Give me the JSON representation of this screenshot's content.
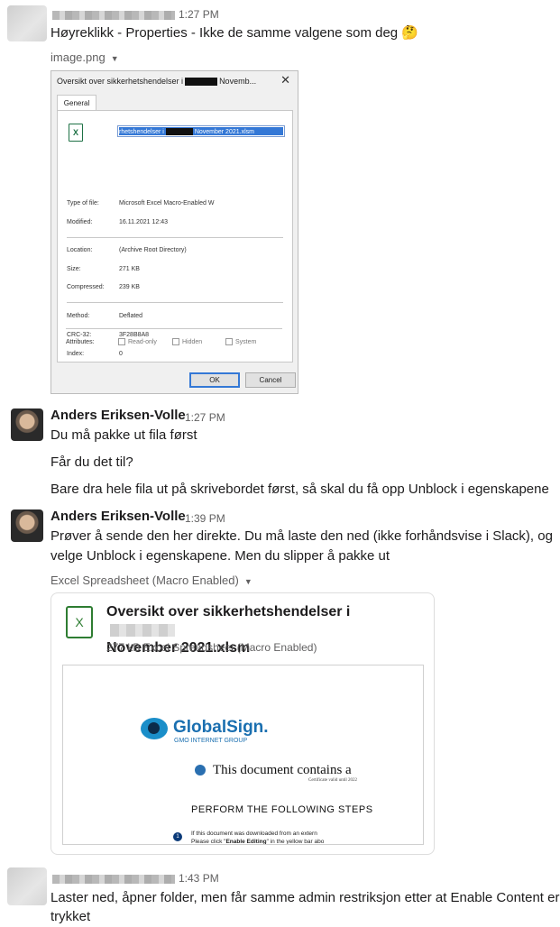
{
  "messages": [
    {
      "time": "1:27 PM",
      "text": "Høyreklikk - Properties - Ikke de samme valgene som deg 🤔",
      "attachment_label": "image.png"
    },
    {
      "sender": "Anders Eriksen-Volle",
      "time": "1:27 PM",
      "lines": [
        "Du må pakke ut fila først",
        "Får du det til?",
        "Bare dra hele fila ut på skrivebordet først, så skal du få opp Unblock i egenskapene"
      ]
    },
    {
      "sender": "Anders Eriksen-Volle",
      "time": "1:39 PM",
      "line1": "Prøver å sende den her direkte. Du må laste den ned (ikke forhåndsvise i Slack), og",
      "line2": "velge Unblock i egenskapene. Men du slipper å pakke ut",
      "attachment_label": "Excel Spreadsheet (Macro Enabled)"
    },
    {
      "time": "1:43 PM",
      "line1": "Laster ned, åpner folder, men får samme admin restriksjon etter at Enable Content er",
      "line2": "trykket"
    }
  ],
  "dialog": {
    "title_start": "Oversikt over sikkerhetshendelser i",
    "title_end": "Novemb...",
    "close_glyph": "✕",
    "tab": "General",
    "filename_start": "rhetshendelser i",
    "filename_end": "November 2021.xlsm",
    "icon_glyph": "X",
    "props": [
      {
        "label": "Type of file:",
        "value": "Microsoft Excel Macro-Enabled W"
      },
      {
        "label": "Modified:",
        "value": "16.11.2021 12:43"
      },
      {
        "label": "Location:",
        "value": "(Archive Root Directory)"
      },
      {
        "label": "Size:",
        "value": "271 KB"
      },
      {
        "label": "Compressed:",
        "value": "239 KB"
      },
      {
        "label": "Method:",
        "value": "Deflated"
      },
      {
        "label": "CRC-32:",
        "value": "3F28B8A8"
      },
      {
        "label": "Index:",
        "value": "0"
      }
    ],
    "attributes_label": "Attributes:",
    "checkboxes": [
      "Read-only",
      "Hidden",
      "System"
    ],
    "ok": "OK",
    "cancel": "Cancel"
  },
  "file_card": {
    "icon_glyph": "X",
    "title_line1": "Oversikt over sikkerhetshendelser i",
    "title_line2": "November 2021.xlsm",
    "subtitle": "277 kB Excel Spreadsheet (Macro Enabled)",
    "preview": {
      "logo": "GlobalSign.",
      "logo_sub": "GMO INTERNET GROUP",
      "line1": "This document contains a",
      "line1_sub": "Certificate valid until 2022",
      "perform": "PERFORM THE FOLLOWING STEPS",
      "step_num": "1",
      "instr1": "If this document was downloaded from an extern",
      "instr2_pre": "Please click \"",
      "instr2_bold": "Enable Editing",
      "instr2_post": "\" in the yellow bar abo"
    }
  },
  "caret_glyph": "▼"
}
